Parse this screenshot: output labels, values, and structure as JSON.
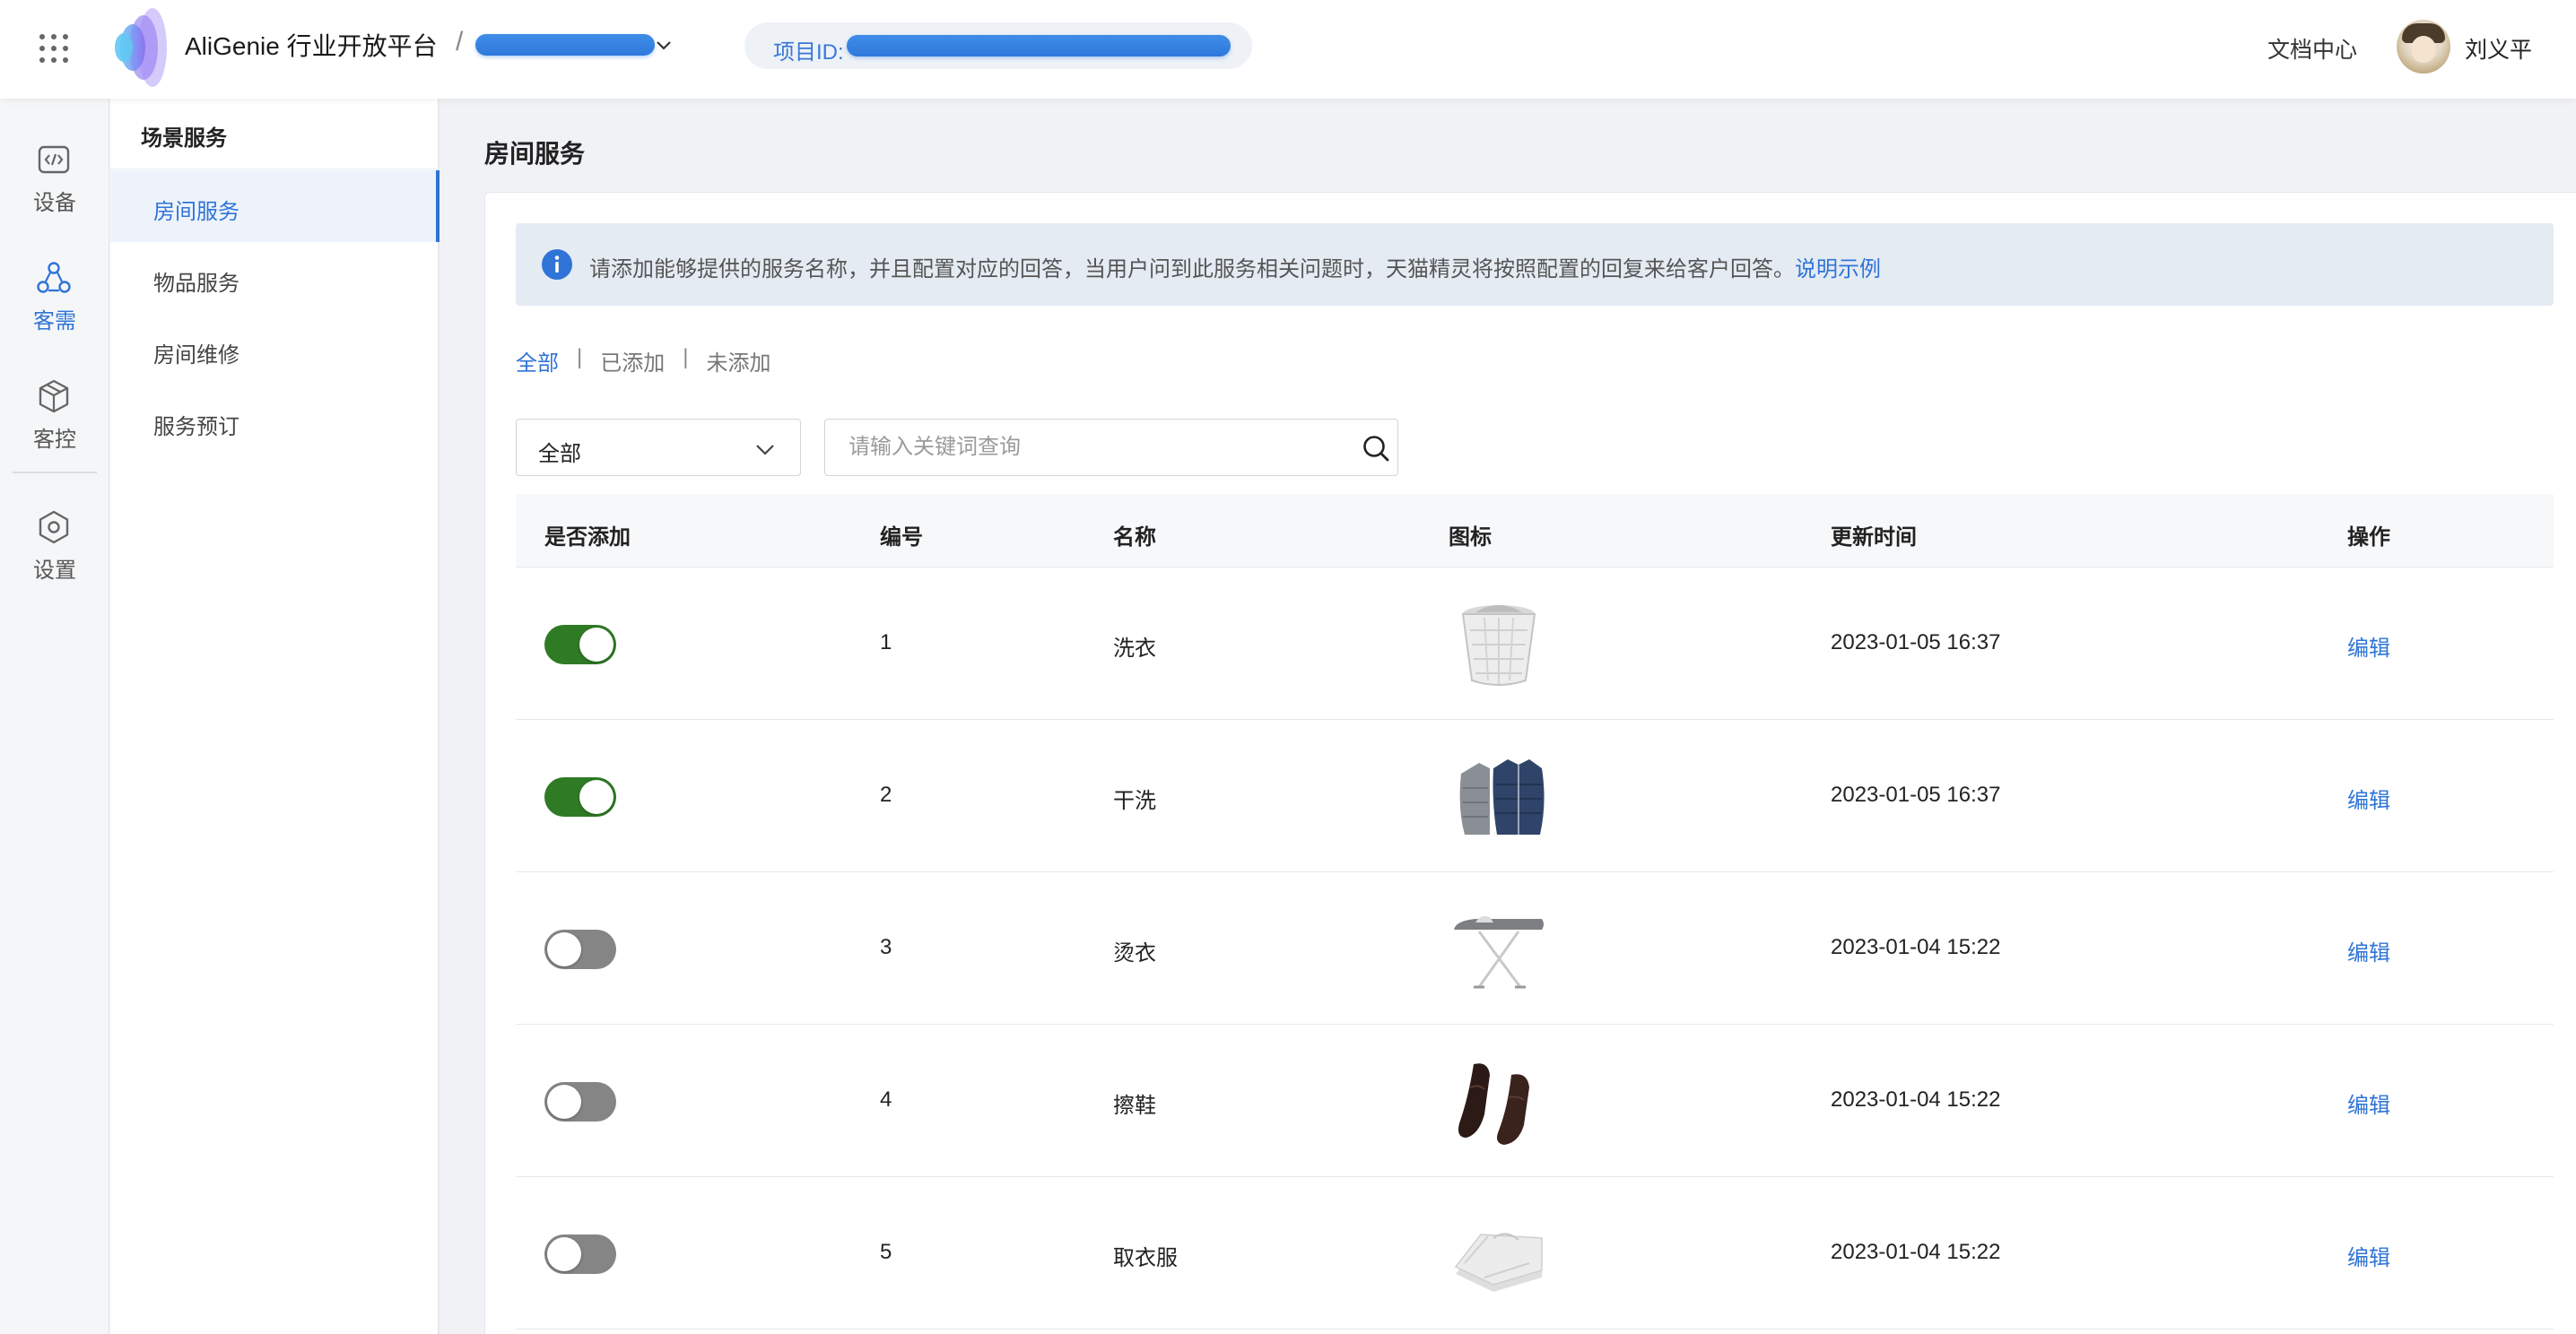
{
  "header": {
    "brand": "AliGenie 行业开放平台",
    "separator": "/",
    "project_id_label": "项目ID:",
    "docs_link": "文档中心",
    "user_name": "刘义平"
  },
  "rail": {
    "items": [
      {
        "label": "设备",
        "icon": "code-icon"
      },
      {
        "label": "客需",
        "icon": "nodes-icon"
      },
      {
        "label": "客控",
        "icon": "cube-icon"
      },
      {
        "label": "设置",
        "icon": "hexagon-gear-icon"
      }
    ],
    "active_index": 1
  },
  "subnav": {
    "title": "场景服务",
    "items": [
      "房间服务",
      "物品服务",
      "房间维修",
      "服务预订"
    ],
    "active_index": 0
  },
  "main": {
    "page_title": "房间服务",
    "notice": {
      "text": "请添加能够提供的服务名称，并且配置对应的回答，当用户问到此服务相关问题时，天猫精灵将按照配置的回复来给客户回答。",
      "link": "说明示例"
    },
    "filter_tabs": [
      "全部",
      "已添加",
      "未添加"
    ],
    "filter_sep": "|",
    "active_tab": 0,
    "select_value": "全部",
    "search_placeholder": "请输入关键词查询",
    "table": {
      "columns": [
        "是否添加",
        "编号",
        "名称",
        "图标",
        "更新时间",
        "操作"
      ],
      "rows": [
        {
          "added": true,
          "no": "1",
          "name": "洗衣",
          "icon": "laundry-basket-icon",
          "updated": "2023-01-05 16:37",
          "action": "编辑"
        },
        {
          "added": true,
          "no": "2",
          "name": "干洗",
          "icon": "down-jacket-icon",
          "updated": "2023-01-05 16:37",
          "action": "编辑"
        },
        {
          "added": false,
          "no": "3",
          "name": "烫衣",
          "icon": "ironing-board-icon",
          "updated": "2023-01-04 15:22",
          "action": "编辑"
        },
        {
          "added": false,
          "no": "4",
          "name": "擦鞋",
          "icon": "leather-shoes-icon",
          "updated": "2023-01-04 15:22",
          "action": "编辑"
        },
        {
          "added": false,
          "no": "5",
          "name": "取衣服",
          "icon": "folded-clothes-icon",
          "updated": "2023-01-04 15:22",
          "action": "编辑"
        }
      ]
    }
  },
  "colors": {
    "accent": "#2f74d6",
    "toggle_on": "#2f7a25",
    "toggle_off": "#858585",
    "notice_bg": "#e5ebf3",
    "page_bg": "#f0f2f5"
  }
}
